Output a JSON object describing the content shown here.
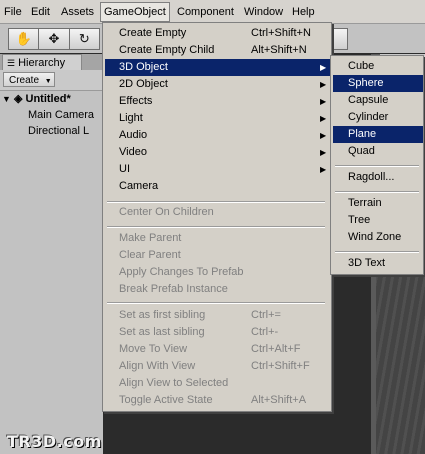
{
  "menubar": {
    "items": [
      "File",
      "Edit",
      "Assets",
      "GameObject",
      "Component",
      "Window",
      "Help"
    ],
    "active": "GameObject"
  },
  "toolbar": {
    "tools": [
      {
        "name": "hand-tool",
        "glyph": "✋"
      },
      {
        "name": "move-tool",
        "glyph": "✥"
      },
      {
        "name": "rotate-tool",
        "glyph": "↻"
      }
    ]
  },
  "hierarchy": {
    "tab_label": "Hierarchy",
    "create_label": "Create",
    "scene": "Untitled*",
    "children": [
      "Main Camera",
      "Directional L"
    ]
  },
  "gameobject_menu": {
    "items": [
      {
        "label": "Create Empty",
        "shortcut": "Ctrl+Shift+N"
      },
      {
        "label": "Create Empty Child",
        "shortcut": "Alt+Shift+N"
      },
      {
        "label": "3D Object",
        "submenu": true,
        "highlighted": true
      },
      {
        "label": "2D Object",
        "submenu": true
      },
      {
        "label": "Effects",
        "submenu": true
      },
      {
        "label": "Light",
        "submenu": true
      },
      {
        "label": "Audio",
        "submenu": true
      },
      {
        "label": "Video",
        "submenu": true
      },
      {
        "label": "UI",
        "submenu": true
      },
      {
        "label": "Camera"
      },
      {
        "label": "Center On Children",
        "disabled": true
      },
      {
        "label": "Make Parent",
        "disabled": true
      },
      {
        "label": "Clear Parent",
        "disabled": true
      },
      {
        "label": "Apply Changes To Prefab",
        "disabled": true
      },
      {
        "label": "Break Prefab Instance",
        "disabled": true
      },
      {
        "label": "Set as first sibling",
        "shortcut": "Ctrl+=",
        "disabled": true
      },
      {
        "label": "Set as last sibling",
        "shortcut": "Ctrl+-",
        "disabled": true
      },
      {
        "label": "Move To View",
        "shortcut": "Ctrl+Alt+F",
        "disabled": true
      },
      {
        "label": "Align With View",
        "shortcut": "Ctrl+Shift+F",
        "disabled": true
      },
      {
        "label": "Align View to Selected",
        "disabled": true
      },
      {
        "label": "Toggle Active State",
        "shortcut": "Alt+Shift+A",
        "disabled": true
      }
    ]
  },
  "object3d_submenu": {
    "items": [
      {
        "label": "Cube"
      },
      {
        "label": "Sphere",
        "highlighted": true
      },
      {
        "label": "Capsule"
      },
      {
        "label": "Cylinder"
      },
      {
        "label": "Plane",
        "highlighted": true
      },
      {
        "label": "Quad"
      },
      {
        "label": "Ragdoll..."
      },
      {
        "label": "Terrain"
      },
      {
        "label": "Tree"
      },
      {
        "label": "Wind Zone"
      },
      {
        "label": "3D Text"
      }
    ]
  },
  "watermark": "TR3D.com",
  "colors": {
    "menu_bg": "#d4d0c8",
    "highlight": "#0a246a",
    "disabled_text": "#808080",
    "toolbar_bg": "#c2c2c2"
  }
}
